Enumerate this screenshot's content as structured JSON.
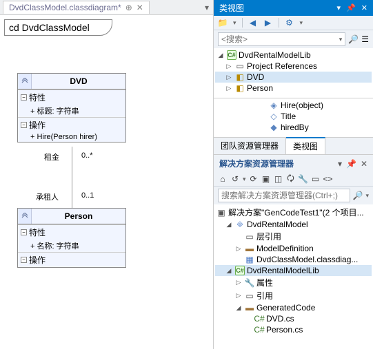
{
  "leftTab": {
    "label": "DvdClassModel.classdiagram*"
  },
  "diagramTitle": "cd DvdClassModel",
  "classDVD": {
    "name": "DVD",
    "propsHeader": "特性",
    "prop1": "+ 标题: 字符串",
    "opsHeader": "操作",
    "op1": "+ Hire(Person hirer)"
  },
  "assoc": {
    "rent": "租金",
    "rentMult": "0..*",
    "tenant": "承租人",
    "tenantMult": "0..1"
  },
  "classPerson": {
    "name": "Person",
    "propsHeader": "特性",
    "prop1": "+ 名称: 字符串",
    "opsHeader": "操作"
  },
  "classView": {
    "title": "类视图",
    "searchPlaceholder": "<搜索>",
    "root": "DvdRentalModelLib",
    "projRefs": "Project References",
    "dvd": "DVD",
    "person": "Person",
    "hire": "Hire(object)",
    "titleProp": "Title",
    "hiredBy": "hiredBy",
    "tab1": "团队资源管理器",
    "tab2": "类视图"
  },
  "sln": {
    "title": "解决方案资源管理器",
    "searchPlaceholder": "搜索解决方案资源管理器(Ctrl+;)",
    "root": "解决方案\"GenCodeTest1\"(2 个项目...",
    "proj1": "DvdRentalModel",
    "layerRef": "层引用",
    "modelDef": "ModelDefinition",
    "diag": "DvdClassModel.classdiag...",
    "proj2": "DvdRentalModelLib",
    "props": "属性",
    "refs": "引用",
    "gen": "GeneratedCode",
    "dvdcs": "DVD.cs",
    "personcs": "Person.cs"
  }
}
